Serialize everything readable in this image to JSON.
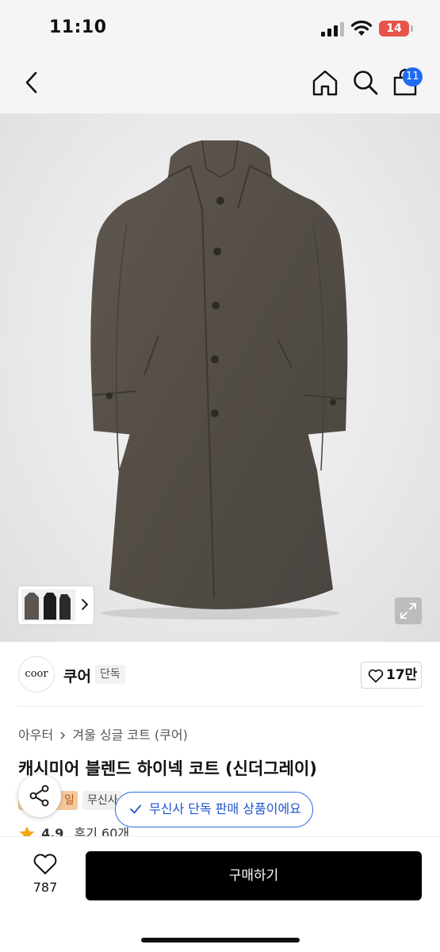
{
  "status_bar": {
    "time": "11:10",
    "battery": "14",
    "battery_color": "#e6544c"
  },
  "nav": {
    "back_icon": "chevron-left-icon",
    "home_icon": "home-icon",
    "search_icon": "search-icon",
    "cart_icon": "shopping-bag-icon",
    "cart_count": "11",
    "badge_color": "#1f6bf0"
  },
  "product_image": {
    "thumbnail_next_icon": "chevron-right-icon",
    "expand_icon": "expand-icon"
  },
  "brand": {
    "logo_text": "coor",
    "name": "쿠어",
    "tag": "단독",
    "like_count": "17만",
    "like_icon": "heart-outline-icon"
  },
  "product": {
    "breadcrumb": [
      "아우터",
      "겨울 싱글 코트 (쿠어)"
    ],
    "title": "캐시미어 블렌드 하이넥 코트 (신더그레이)",
    "badge_orange": "일",
    "badge_gray": "무신사",
    "rating": "4.9",
    "review_text": "후기 60개",
    "rating_color": "#f3a81a"
  },
  "floating": {
    "share_icon": "share-icon",
    "toast_text": "무신사 단독 판매 상품이에요",
    "toast_icon": "checkmark-icon"
  },
  "bottom_bar": {
    "wish_count": "787",
    "wish_icon": "heart-outline-icon",
    "buy_label": "구매하기"
  }
}
